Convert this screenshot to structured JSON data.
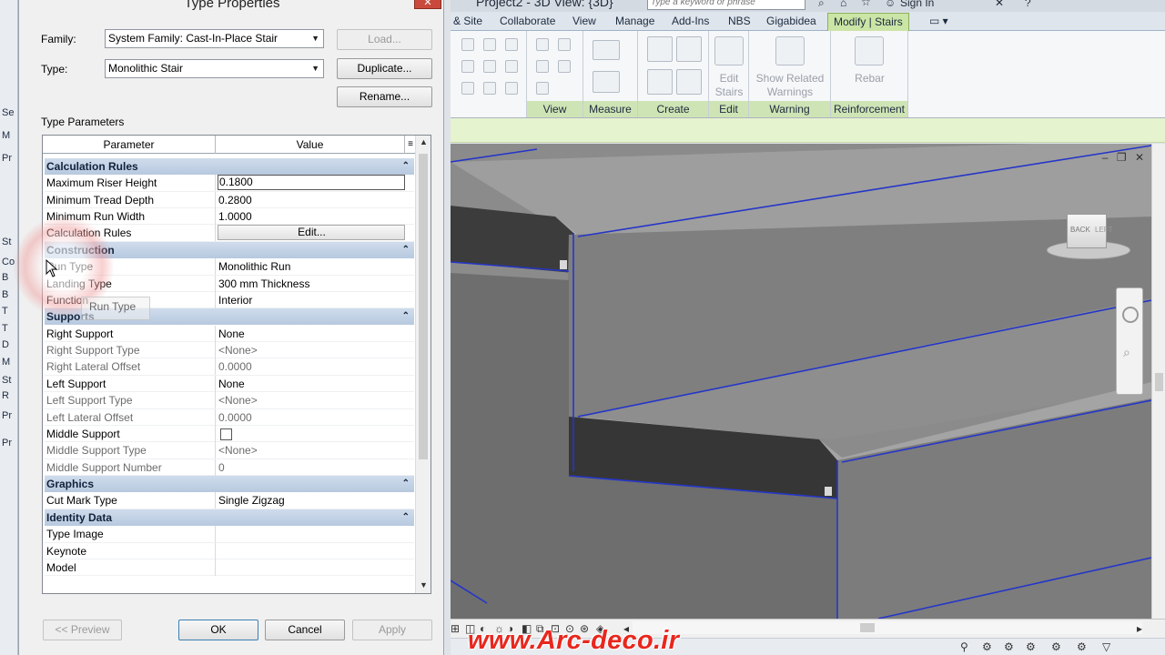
{
  "dialog": {
    "title": "Type Properties",
    "close_label": "✕",
    "family_label": "Family:",
    "family_value": "System Family: Cast-In-Place Stair",
    "type_label": "Type:",
    "type_value": "Monolithic Stair",
    "load_label": "Load...",
    "duplicate_label": "Duplicate...",
    "rename_label": "Rename...",
    "type_parameters_label": "Type Parameters",
    "grid_header": {
      "parameter": "Parameter",
      "value": "Value"
    },
    "groups": [
      {
        "name": "Calculation Rules",
        "rows": [
          {
            "param": "Maximum Riser Height",
            "value": "0.1800"
          },
          {
            "param": "Minimum Tread Depth",
            "value": "0.2800"
          },
          {
            "param": "Minimum Run Width",
            "value": "1.0000"
          },
          {
            "param": "Calculation Rules",
            "value": "Edit..."
          }
        ]
      },
      {
        "name": "Construction",
        "rows": [
          {
            "param": "Run Type",
            "value": "Monolithic Run"
          },
          {
            "param": "Landing Type",
            "value": "300 mm Thickness"
          },
          {
            "param": "Function",
            "value": "Interior"
          }
        ]
      },
      {
        "name": "Supports",
        "rows": [
          {
            "param": "Right Support",
            "value": "None"
          },
          {
            "param": "Right Support Type",
            "value": "<None>"
          },
          {
            "param": "Right Lateral Offset",
            "value": "0.0000"
          },
          {
            "param": "Left Support",
            "value": "None"
          },
          {
            "param": "Left Support Type",
            "value": "<None>"
          },
          {
            "param": "Left Lateral Offset",
            "value": "0.0000"
          },
          {
            "param": "Middle Support",
            "value": ""
          },
          {
            "param": "Middle Support Type",
            "value": "<None>"
          },
          {
            "param": "Middle Support Number",
            "value": "0"
          }
        ]
      },
      {
        "name": "Graphics",
        "rows": [
          {
            "param": "Cut Mark Type",
            "value": "Single Zigzag"
          }
        ]
      },
      {
        "name": "Identity Data",
        "rows": [
          {
            "param": "Type Image",
            "value": ""
          },
          {
            "param": "Keynote",
            "value": ""
          },
          {
            "param": "Model",
            "value": ""
          }
        ]
      }
    ],
    "tooltip": "Run Type",
    "preview_label": "<< Preview",
    "ok_label": "OK",
    "cancel_label": "Cancel",
    "apply_label": "Apply"
  },
  "app_left": [
    "Se",
    "M",
    "Pr",
    "St",
    "Co",
    "B",
    "B",
    "T",
    "T",
    "D",
    "M",
    "St",
    "R",
    "Pr",
    "Pr"
  ],
  "revit": {
    "title": "Project2 - 3D View: {3D}",
    "search_placeholder": "Type a keyword or phrase",
    "sign_in": "Sign In",
    "tabs": [
      "& Site",
      "Collaborate",
      "View",
      "Manage",
      "Add-Ins",
      "NBS",
      "Gigabidea",
      "Modify | Stairs"
    ],
    "active_tab": "Modify | Stairs",
    "panels": [
      "View",
      "Measure",
      "Create",
      "Edit",
      "Warning",
      "Reinforcement"
    ],
    "buttons": {
      "edit_stairs": "Edit Stairs",
      "show_related_warnings": "Show Related Warnings",
      "rebar": "Rebar"
    },
    "viewcube_labels": [
      "BACK",
      "LEFT"
    ]
  },
  "watermark": "www.Arc-deco.ir",
  "colors": {
    "ribbon_panel_title": "#cfe4b5",
    "group_header": "#b7c9df",
    "edge_highlight": "#2536c8",
    "watermark": "#e8271e"
  }
}
